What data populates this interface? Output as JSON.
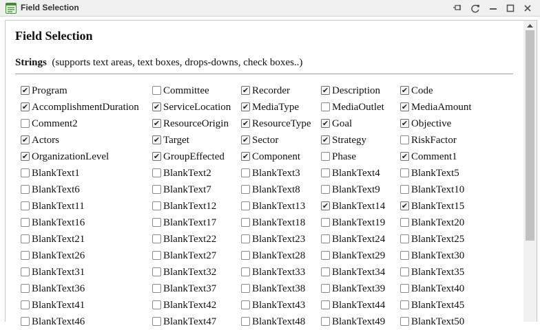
{
  "window": {
    "title": "Field Selection",
    "icon": "list-form-icon",
    "controls": [
      "pin-icon",
      "refresh-icon",
      "minimize-icon",
      "maximize-icon",
      "close-icon"
    ]
  },
  "page": {
    "heading": "Field Selection",
    "section_title": "Strings",
    "section_note": "(supports text areas, text boxes, drops-downs, check boxes..)"
  },
  "fields": [
    {
      "label": "Program",
      "checked": true
    },
    {
      "label": "Committee",
      "checked": false
    },
    {
      "label": "Recorder",
      "checked": true
    },
    {
      "label": "Description",
      "checked": true
    },
    {
      "label": "Code",
      "checked": true
    },
    {
      "label": "AccomplishmentDuration",
      "checked": true
    },
    {
      "label": "ServiceLocation",
      "checked": true
    },
    {
      "label": "MediaType",
      "checked": true
    },
    {
      "label": "MediaOutlet",
      "checked": false
    },
    {
      "label": "MediaAmount",
      "checked": true
    },
    {
      "label": "Comment2",
      "checked": false
    },
    {
      "label": "ResourceOrigin",
      "checked": true
    },
    {
      "label": "ResourceType",
      "checked": true
    },
    {
      "label": "Goal",
      "checked": true
    },
    {
      "label": "Objective",
      "checked": true
    },
    {
      "label": "Actors",
      "checked": true
    },
    {
      "label": "Target",
      "checked": true
    },
    {
      "label": "Sector",
      "checked": true
    },
    {
      "label": "Strategy",
      "checked": true
    },
    {
      "label": "RiskFactor",
      "checked": false
    },
    {
      "label": "OrganizationLevel",
      "checked": true
    },
    {
      "label": "GroupEffected",
      "checked": true
    },
    {
      "label": "Component",
      "checked": true
    },
    {
      "label": "Phase",
      "checked": false
    },
    {
      "label": "Comment1",
      "checked": true
    },
    {
      "label": "BlankText1",
      "checked": false
    },
    {
      "label": "BlankText2",
      "checked": false
    },
    {
      "label": "BlankText3",
      "checked": false
    },
    {
      "label": "BlankText4",
      "checked": false
    },
    {
      "label": "BlankText5",
      "checked": false
    },
    {
      "label": "BlankText6",
      "checked": false
    },
    {
      "label": "BlankText7",
      "checked": false
    },
    {
      "label": "BlankText8",
      "checked": false
    },
    {
      "label": "BlankText9",
      "checked": false
    },
    {
      "label": "BlankText10",
      "checked": false
    },
    {
      "label": "BlankText11",
      "checked": false
    },
    {
      "label": "BlankText12",
      "checked": false
    },
    {
      "label": "BlankText13",
      "checked": false
    },
    {
      "label": "BlankText14",
      "checked": true
    },
    {
      "label": "BlankText15",
      "checked": true
    },
    {
      "label": "BlankText16",
      "checked": false
    },
    {
      "label": "BlankText17",
      "checked": false
    },
    {
      "label": "BlankText18",
      "checked": false
    },
    {
      "label": "BlankText19",
      "checked": false
    },
    {
      "label": "BlankText20",
      "checked": false
    },
    {
      "label": "BlankText21",
      "checked": false
    },
    {
      "label": "BlankText22",
      "checked": false
    },
    {
      "label": "BlankText23",
      "checked": false
    },
    {
      "label": "BlankText24",
      "checked": false
    },
    {
      "label": "BlankText25",
      "checked": false
    },
    {
      "label": "BlankText26",
      "checked": false
    },
    {
      "label": "BlankText27",
      "checked": false
    },
    {
      "label": "BlankText28",
      "checked": false
    },
    {
      "label": "BlankText29",
      "checked": false
    },
    {
      "label": "BlankText30",
      "checked": false
    },
    {
      "label": "BlankText31",
      "checked": false
    },
    {
      "label": "BlankText32",
      "checked": false
    },
    {
      "label": "BlankText33",
      "checked": false
    },
    {
      "label": "BlankText34",
      "checked": false
    },
    {
      "label": "BlankText35",
      "checked": false
    },
    {
      "label": "BlankText36",
      "checked": false
    },
    {
      "label": "BlankText37",
      "checked": false
    },
    {
      "label": "BlankText38",
      "checked": false
    },
    {
      "label": "BlankText39",
      "checked": false
    },
    {
      "label": "BlankText40",
      "checked": false
    },
    {
      "label": "BlankText41",
      "checked": false
    },
    {
      "label": "BlankText42",
      "checked": false
    },
    {
      "label": "BlankText43",
      "checked": false
    },
    {
      "label": "BlankText44",
      "checked": false
    },
    {
      "label": "BlankText45",
      "checked": false
    },
    {
      "label": "BlankText46",
      "checked": false
    },
    {
      "label": "BlankText47",
      "checked": false
    },
    {
      "label": "BlankText48",
      "checked": false
    },
    {
      "label": "BlankText49",
      "checked": false
    },
    {
      "label": "BlankText50",
      "checked": false
    }
  ]
}
